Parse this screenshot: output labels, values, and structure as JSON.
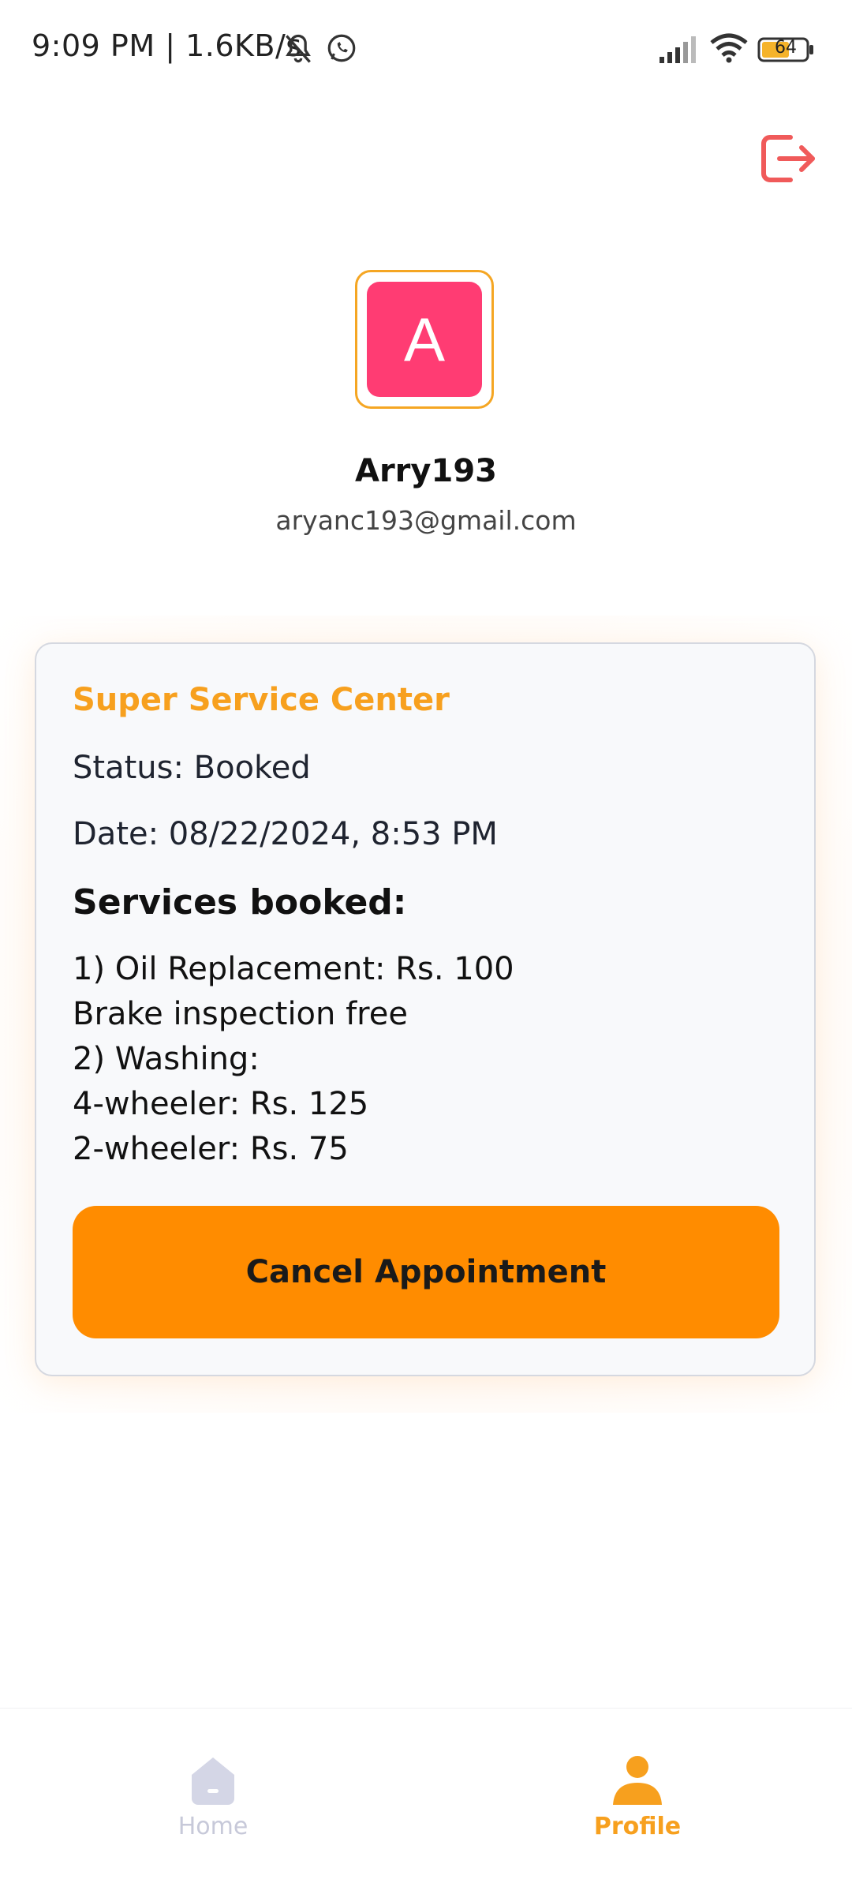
{
  "status_bar": {
    "text": "9:09 PM | 1.6KB/s",
    "battery": "64",
    "icons": [
      "bell-off-icon",
      "whatsapp-icon",
      "signal-icon",
      "wifi-icon",
      "battery-icon"
    ]
  },
  "header": {
    "logout_icon": "logout-icon",
    "logout_color": "#F05A5A"
  },
  "profile": {
    "avatar_letter": "A",
    "avatar_color": "#FF3C73",
    "avatar_border_color": "#F5A623",
    "name": "Arry193",
    "email": "aryanc193@gmail.com"
  },
  "appointment": {
    "center_name": "Super Service Center",
    "status": "Status: Booked",
    "date": "Date: 08/22/2024, 8:53 PM",
    "services_heading": "Services booked:",
    "services": [
      {
        "line1": "1) Oil Replacement: Rs. 100",
        "line2": "Brake inspection free"
      },
      {
        "line1": "2) Washing:",
        "line2": "4-wheeler: Rs. 125",
        "line3": "2-wheeler: Rs. 75"
      }
    ],
    "cancel_label": "Cancel Appointment",
    "accent_color": "#FF8C00"
  },
  "bottom_nav": {
    "items": [
      {
        "label": "Home",
        "icon": "home-icon",
        "active": false
      },
      {
        "label": "Profile",
        "icon": "profile-icon",
        "active": true
      }
    ],
    "active_color": "#F7A01E",
    "inactive_color": "#C7C9D9"
  }
}
